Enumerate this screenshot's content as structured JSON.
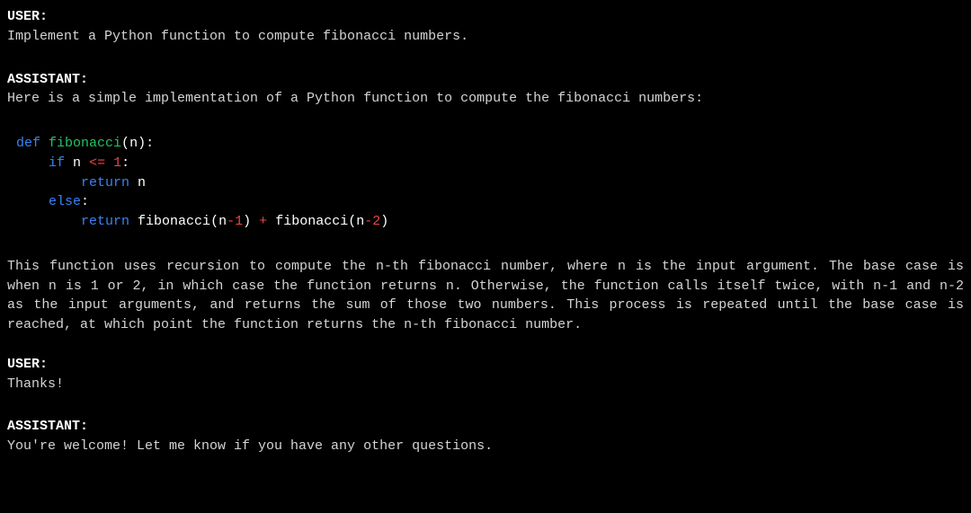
{
  "conversation": {
    "turn1": {
      "role": "USER:",
      "text": "Implement a Python function to compute fibonacci numbers."
    },
    "turn2": {
      "role": "ASSISTANT:",
      "intro": "Here is a simple implementation of a Python function to compute the fibonacci numbers:",
      "code": {
        "def": "def",
        "funcname": "fibonacci",
        "lparen1": "(",
        "param_n": "n",
        "rparen_colon1": "):",
        "if": "if",
        "n1": "n",
        "lte": "<=",
        "one": "1",
        "colon1": ":",
        "return1": "return",
        "n2": "n",
        "else": "else",
        "colon2": ":",
        "return2": "return",
        "call1": "fibonacci",
        "lparen2": "(",
        "n3": "n",
        "minus1": "-",
        "num1": "1",
        "rparen2": ")",
        "plus": "+",
        "call2": "fibonacci",
        "lparen3": "(",
        "n4": "n",
        "minus2": "-",
        "num2": "2",
        "rparen3": ")"
      },
      "explanation": "This function uses recursion to compute the n-th fibonacci number, where n is the input argument. The base case is when n is 1 or 2, in which case the function returns n. Otherwise, the function calls itself twice, with n-1 and n-2 as the input arguments, and returns the sum of those two numbers. This process is repeated until the base case is reached, at which point the function returns the n-th fibonacci number."
    },
    "turn3": {
      "role": "USER:",
      "text": "Thanks!"
    },
    "turn4": {
      "role": "ASSISTANT:",
      "text": "You're welcome! Let me know if you have any other questions."
    }
  }
}
